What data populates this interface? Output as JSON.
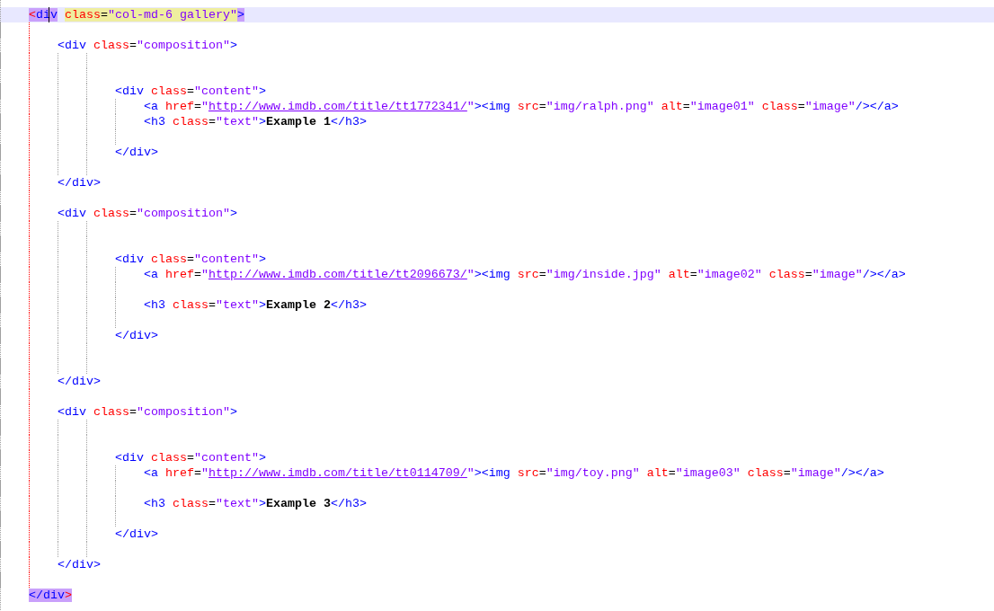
{
  "editor": {
    "lines": [
      {
        "kind": "code",
        "current": true,
        "matched": true,
        "tokens": [
          {
            "kind": "brace",
            "text": "<"
          },
          {
            "kind": "tag",
            "text": "di"
          },
          {
            "kind": "caret"
          },
          {
            "kind": "tag",
            "text": "v"
          },
          {
            "kind": "attr",
            "text": " class"
          },
          {
            "kind": "eq",
            "text": "="
          },
          {
            "kind": "value",
            "text": "\"col-md-6 gallery\""
          },
          {
            "kind": "tag",
            "text": ">"
          }
        ],
        "children": [
          {
            "kind": "blank",
            "current": false
          },
          {
            "kind": "code",
            "current": false,
            "matched": false,
            "tokens": [
              {
                "kind": "tag",
                "text": "<div"
              },
              {
                "kind": "attr",
                "text": " class"
              },
              {
                "kind": "eq",
                "text": "="
              },
              {
                "kind": "value",
                "text": "\"composition\""
              },
              {
                "kind": "tag",
                "text": ">"
              }
            ],
            "children": [
              {
                "kind": "blank",
                "current": false
              },
              {
                "kind": "blank",
                "current": false
              },
              {
                "kind": "code",
                "current": false,
                "matched": false,
                "tokens": [
                  {
                    "kind": "tag",
                    "text": "<div"
                  },
                  {
                    "kind": "attr",
                    "text": " class"
                  },
                  {
                    "kind": "eq",
                    "text": "="
                  },
                  {
                    "kind": "value",
                    "text": "\"content\""
                  },
                  {
                    "kind": "tag",
                    "text": ">"
                  }
                ],
                "children": [
                  {
                    "kind": "code",
                    "current": false,
                    "matched": false,
                    "tokens": [
                      {
                        "kind": "tag",
                        "text": "<a"
                      },
                      {
                        "kind": "attr",
                        "text": " href"
                      },
                      {
                        "kind": "eq",
                        "text": "="
                      },
                      {
                        "kind": "value",
                        "text": "\""
                      },
                      {
                        "kind": "url",
                        "text": "http://www.imdb.com/title/tt1772341/"
                      },
                      {
                        "kind": "value",
                        "text": "\""
                      },
                      {
                        "kind": "tag",
                        "text": "><img"
                      },
                      {
                        "kind": "attr",
                        "text": " src"
                      },
                      {
                        "kind": "eq",
                        "text": "="
                      },
                      {
                        "kind": "value",
                        "text": "\"img/ralph.png\""
                      },
                      {
                        "kind": "attr",
                        "text": " alt"
                      },
                      {
                        "kind": "eq",
                        "text": "="
                      },
                      {
                        "kind": "value",
                        "text": "\"image01\""
                      },
                      {
                        "kind": "attr",
                        "text": " class"
                      },
                      {
                        "kind": "eq",
                        "text": "="
                      },
                      {
                        "kind": "value",
                        "text": "\"image\""
                      },
                      {
                        "kind": "tag",
                        "text": "/></a>"
                      }
                    ]
                  },
                  {
                    "kind": "code",
                    "current": false,
                    "matched": false,
                    "tokens": [
                      {
                        "kind": "tag",
                        "text": "<h3"
                      },
                      {
                        "kind": "attr",
                        "text": " class"
                      },
                      {
                        "kind": "eq",
                        "text": "="
                      },
                      {
                        "kind": "value",
                        "text": "\"text\""
                      },
                      {
                        "kind": "tag",
                        "text": ">"
                      },
                      {
                        "kind": "text",
                        "text": "Example 1"
                      },
                      {
                        "kind": "tag",
                        "text": "</h3>"
                      }
                    ]
                  },
                  {
                    "kind": "blank",
                    "current": false
                  }
                ]
              },
              {
                "kind": "code",
                "current": false,
                "matched": false,
                "tokens": [
                  {
                    "kind": "tag",
                    "text": "</div>"
                  }
                ]
              },
              {
                "kind": "blank",
                "current": false
              }
            ]
          },
          {
            "kind": "code",
            "current": false,
            "matched": false,
            "tokens": [
              {
                "kind": "tag",
                "text": "</div>"
              }
            ]
          },
          {
            "kind": "blank",
            "current": false
          },
          {
            "kind": "code",
            "current": false,
            "matched": false,
            "tokens": [
              {
                "kind": "tag",
                "text": "<div"
              },
              {
                "kind": "attr",
                "text": " class"
              },
              {
                "kind": "eq",
                "text": "="
              },
              {
                "kind": "value",
                "text": "\"composition\""
              },
              {
                "kind": "tag",
                "text": ">"
              }
            ],
            "children": [
              {
                "kind": "blank",
                "current": false
              },
              {
                "kind": "blank",
                "current": false
              },
              {
                "kind": "code",
                "current": false,
                "matched": false,
                "tokens": [
                  {
                    "kind": "tag",
                    "text": "<div"
                  },
                  {
                    "kind": "attr",
                    "text": " class"
                  },
                  {
                    "kind": "eq",
                    "text": "="
                  },
                  {
                    "kind": "value",
                    "text": "\"content\""
                  },
                  {
                    "kind": "tag",
                    "text": ">"
                  }
                ],
                "children": [
                  {
                    "kind": "code",
                    "current": false,
                    "matched": false,
                    "tokens": [
                      {
                        "kind": "tag",
                        "text": "<a"
                      },
                      {
                        "kind": "attr",
                        "text": " href"
                      },
                      {
                        "kind": "eq",
                        "text": "="
                      },
                      {
                        "kind": "value",
                        "text": "\""
                      },
                      {
                        "kind": "url",
                        "text": "http://www.imdb.com/title/tt2096673/"
                      },
                      {
                        "kind": "value",
                        "text": "\""
                      },
                      {
                        "kind": "tag",
                        "text": "><img"
                      },
                      {
                        "kind": "attr",
                        "text": " src"
                      },
                      {
                        "kind": "eq",
                        "text": "="
                      },
                      {
                        "kind": "value",
                        "text": "\"img/inside.jpg\""
                      },
                      {
                        "kind": "attr",
                        "text": " alt"
                      },
                      {
                        "kind": "eq",
                        "text": "="
                      },
                      {
                        "kind": "value",
                        "text": "\"image02\""
                      },
                      {
                        "kind": "attr",
                        "text": " class"
                      },
                      {
                        "kind": "eq",
                        "text": "="
                      },
                      {
                        "kind": "value",
                        "text": "\"image\""
                      },
                      {
                        "kind": "tag",
                        "text": "/></a>"
                      }
                    ]
                  },
                  {
                    "kind": "blank",
                    "current": false
                  },
                  {
                    "kind": "code",
                    "current": false,
                    "matched": false,
                    "tokens": [
                      {
                        "kind": "tag",
                        "text": "<h3"
                      },
                      {
                        "kind": "attr",
                        "text": " class"
                      },
                      {
                        "kind": "eq",
                        "text": "="
                      },
                      {
                        "kind": "value",
                        "text": "\"text\""
                      },
                      {
                        "kind": "tag",
                        "text": ">"
                      },
                      {
                        "kind": "text",
                        "text": "Example 2"
                      },
                      {
                        "kind": "tag",
                        "text": "</h3>"
                      }
                    ]
                  },
                  {
                    "kind": "blank",
                    "current": false
                  }
                ]
              },
              {
                "kind": "code",
                "current": false,
                "matched": false,
                "tokens": [
                  {
                    "kind": "tag",
                    "text": "</div>"
                  }
                ]
              },
              {
                "kind": "blank",
                "current": false
              },
              {
                "kind": "blank",
                "current": false
              }
            ]
          },
          {
            "kind": "code",
            "current": false,
            "matched": false,
            "tokens": [
              {
                "kind": "tag",
                "text": "</div>"
              }
            ]
          },
          {
            "kind": "blank",
            "current": false
          },
          {
            "kind": "code",
            "current": false,
            "matched": false,
            "tokens": [
              {
                "kind": "tag",
                "text": "<div"
              },
              {
                "kind": "attr",
                "text": " class"
              },
              {
                "kind": "eq",
                "text": "="
              },
              {
                "kind": "value",
                "text": "\"composition\""
              },
              {
                "kind": "tag",
                "text": ">"
              }
            ],
            "children": [
              {
                "kind": "blank",
                "current": false
              },
              {
                "kind": "blank",
                "current": false
              },
              {
                "kind": "code",
                "current": false,
                "matched": false,
                "tokens": [
                  {
                    "kind": "tag",
                    "text": "<div"
                  },
                  {
                    "kind": "attr",
                    "text": " class"
                  },
                  {
                    "kind": "eq",
                    "text": "="
                  },
                  {
                    "kind": "value",
                    "text": "\"content\""
                  },
                  {
                    "kind": "tag",
                    "text": ">"
                  }
                ],
                "children": [
                  {
                    "kind": "code",
                    "current": false,
                    "matched": false,
                    "tokens": [
                      {
                        "kind": "tag",
                        "text": "<a"
                      },
                      {
                        "kind": "attr",
                        "text": " href"
                      },
                      {
                        "kind": "eq",
                        "text": "="
                      },
                      {
                        "kind": "value",
                        "text": "\""
                      },
                      {
                        "kind": "url",
                        "text": "http://www.imdb.com/title/tt0114709/"
                      },
                      {
                        "kind": "value",
                        "text": "\""
                      },
                      {
                        "kind": "tag",
                        "text": "><img"
                      },
                      {
                        "kind": "attr",
                        "text": " src"
                      },
                      {
                        "kind": "eq",
                        "text": "="
                      },
                      {
                        "kind": "value",
                        "text": "\"img/toy.png\""
                      },
                      {
                        "kind": "attr",
                        "text": " alt"
                      },
                      {
                        "kind": "eq",
                        "text": "="
                      },
                      {
                        "kind": "value",
                        "text": "\"image03\""
                      },
                      {
                        "kind": "attr",
                        "text": " class"
                      },
                      {
                        "kind": "eq",
                        "text": "="
                      },
                      {
                        "kind": "value",
                        "text": "\"image\""
                      },
                      {
                        "kind": "tag",
                        "text": "/></a>"
                      }
                    ]
                  },
                  {
                    "kind": "blank",
                    "current": false
                  },
                  {
                    "kind": "code",
                    "current": false,
                    "matched": false,
                    "tokens": [
                      {
                        "kind": "tag",
                        "text": "<h3"
                      },
                      {
                        "kind": "attr",
                        "text": " class"
                      },
                      {
                        "kind": "eq",
                        "text": "="
                      },
                      {
                        "kind": "value",
                        "text": "\"text\""
                      },
                      {
                        "kind": "tag",
                        "text": ">"
                      },
                      {
                        "kind": "text",
                        "text": "Example 3"
                      },
                      {
                        "kind": "tag",
                        "text": "</h3>"
                      }
                    ]
                  },
                  {
                    "kind": "blank",
                    "current": false
                  }
                ]
              },
              {
                "kind": "code",
                "current": false,
                "matched": false,
                "tokens": [
                  {
                    "kind": "tag",
                    "text": "</div>"
                  }
                ]
              },
              {
                "kind": "blank",
                "current": false
              }
            ]
          },
          {
            "kind": "code",
            "current": false,
            "matched": false,
            "tokens": [
              {
                "kind": "tag",
                "text": "</div>"
              }
            ]
          },
          {
            "kind": "blank",
            "current": false
          }
        ]
      },
      {
        "kind": "code",
        "current": false,
        "matched": true,
        "tokens": [
          {
            "kind": "tag",
            "text": "</div"
          },
          {
            "kind": "brace",
            "text": ">"
          }
        ]
      }
    ]
  }
}
